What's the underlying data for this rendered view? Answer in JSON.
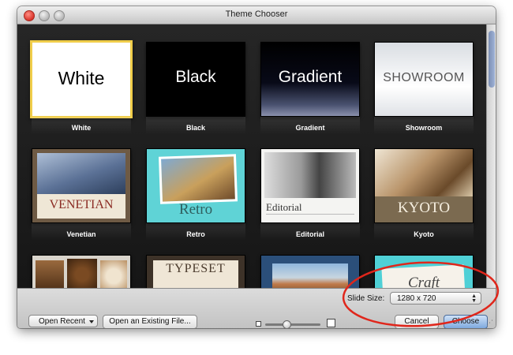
{
  "window": {
    "title": "Theme Chooser"
  },
  "themes": [
    {
      "label": "White",
      "big": "White",
      "selected": true
    },
    {
      "label": "Black",
      "big": "Black"
    },
    {
      "label": "Gradient",
      "big": "Gradient"
    },
    {
      "label": "Showroom",
      "big": "SHOWROOM"
    },
    {
      "label": "Venetian",
      "big": "VENETIAN"
    },
    {
      "label": "Retro",
      "big": "Retro"
    },
    {
      "label": "Editorial",
      "big": "Editorial"
    },
    {
      "label": "Kyoto",
      "big": "KYOTO"
    },
    {
      "label": "",
      "big": ""
    },
    {
      "label": "",
      "big": "TYPESET"
    },
    {
      "label": "",
      "big": ""
    },
    {
      "label": "",
      "big": "Craft"
    }
  ],
  "footer": {
    "slide_size_label": "Slide Size:",
    "slide_size_value": "1280 x 720",
    "open_recent": "Open Recent",
    "open_existing": "Open an Existing File...",
    "cancel": "Cancel",
    "choose": "Choose",
    "zoom_level": 0.35
  },
  "colors": {
    "selection": "#f0cd4a",
    "annotation": "#e0261b"
  }
}
